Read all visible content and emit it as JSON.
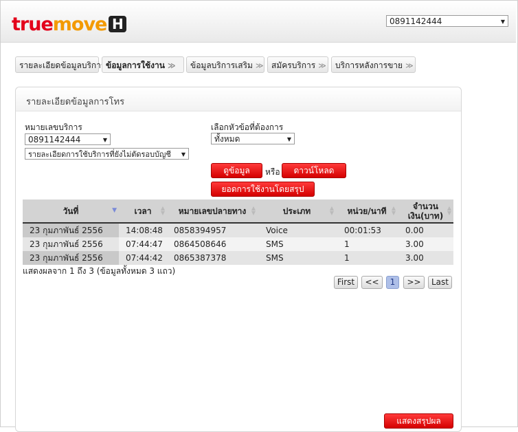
{
  "brand": {
    "logo_true": "true",
    "logo_move": "move",
    "logo_h": "H"
  },
  "header": {
    "number_select": "0891142444"
  },
  "tabs": [
    {
      "label": "รายละเอียดข้อมูลบริการ",
      "has_chevron": false
    },
    {
      "label": "ข้อมูลการใช้งาน",
      "has_chevron": true,
      "active": true
    },
    {
      "label": "ข้อมูลบริการเสริม",
      "has_chevron": true
    },
    {
      "label": "สมัครบริการ",
      "has_chevron": true
    },
    {
      "label": "บริการหลังการขาย",
      "has_chevron": true
    }
  ],
  "chevron_glyph": "≫",
  "panel": {
    "title": "รายละเอียดข้อมูลการโทร",
    "service_number_label": "หมายเลขบริการ",
    "service_number_value": "0891142444",
    "detail_type_value": "รายละเอียดการใช้บริการที่ยังไม่ตัดรอบบัญชี",
    "topic_label": "เลือกหัวข้อที่ต้องการ",
    "topic_value": "ทั้งหมด",
    "view_button": "ดูข้อมูล",
    "or_text": "หรือ",
    "download_button": "ดาวน์โหลด",
    "summary_button": "ยอดการใช้งานโดยสรุป",
    "show_summary_button": "แสดงสรุปผล"
  },
  "table": {
    "columns": [
      "วันที่",
      "เวลา",
      "หมายเลขปลายทาง",
      "ประเภท",
      "หน่วย/นาที",
      "จำนวน เงิน(บาท)"
    ],
    "col_amount_line1": "จำนวน",
    "col_amount_line2": "เงิน(บาท)",
    "rows": [
      [
        "23 กุมภาพันธ์ 2556",
        "14:08:48",
        "0858394957",
        "Voice",
        "00:01:53",
        "0.00"
      ],
      [
        "23 กุมภาพันธ์ 2556",
        "07:44:47",
        "0864508646",
        "SMS",
        "1",
        "3.00"
      ],
      [
        "23 กุมภาพันธ์ 2556",
        "07:44:42",
        "0865387378",
        "SMS",
        "1",
        "3.00"
      ]
    ],
    "summary_text": "แสดงผลจาก 1 ถึง 3 (ข้อมูลทั้งหมด 3 แถว)"
  },
  "pagination": {
    "first": "First",
    "prev": "<<",
    "current": "1",
    "next": ">>",
    "last": "Last"
  },
  "colors": {
    "brand_red": "#e3001b",
    "brand_orange": "#f39a00",
    "button_red": "#e00000",
    "current_page": "#aebfe8"
  }
}
